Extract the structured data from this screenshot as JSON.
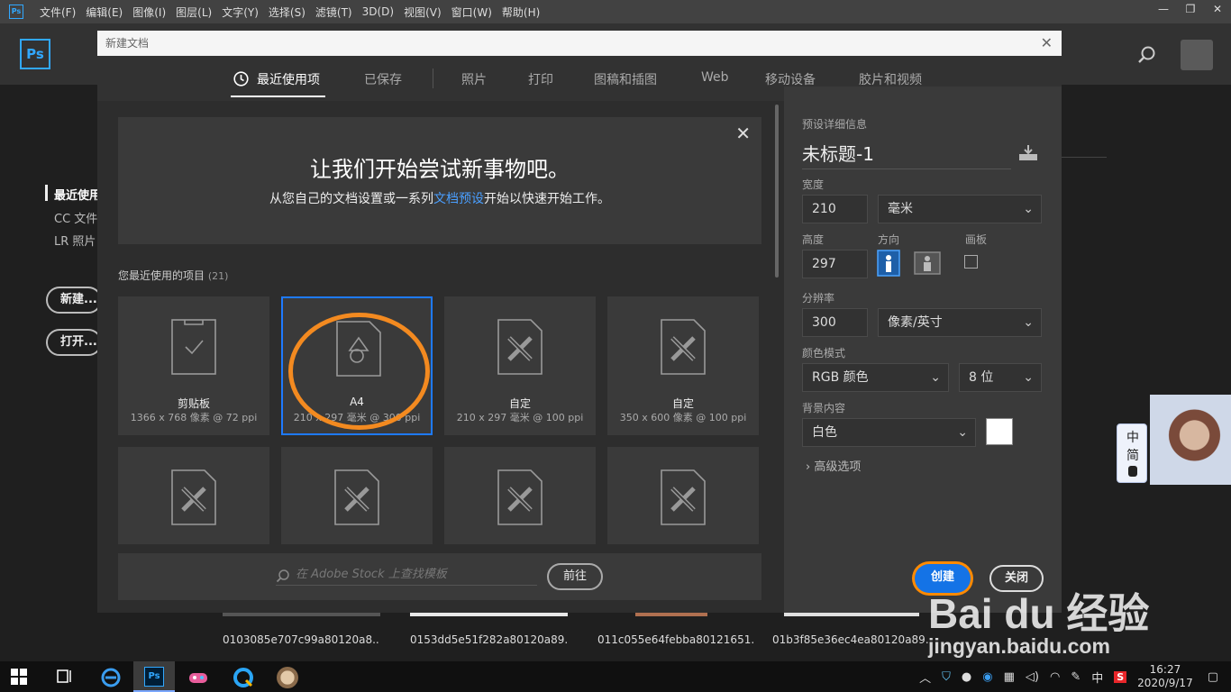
{
  "menubar": {
    "app_icon": "Ps",
    "items": [
      "文件(F)",
      "编辑(E)",
      "图像(I)",
      "图层(L)",
      "文字(Y)",
      "选择(S)",
      "滤镜(T)",
      "3D(D)",
      "视图(V)",
      "窗口(W)",
      "帮助(H)"
    ],
    "window_controls": [
      "—",
      "❐",
      "✕"
    ]
  },
  "home": {
    "logo": "Ps",
    "sidebar": [
      "最近使用",
      "CC 文件",
      "LR 照片"
    ],
    "new_button": "新建...",
    "open_button": "打开...",
    "recent_files": [
      {
        "name": "0103085e707c99a80120a8..."
      },
      {
        "name": "0153dd5e51f282a80120a89..."
      },
      {
        "name": "011c055e64febba80121651..."
      },
      {
        "name": "01b3f85e36ec4ea80120a89..."
      }
    ]
  },
  "dialog": {
    "title": "新建文档",
    "close_glyph": "✕",
    "tabs": [
      "最近使用项",
      "已保存",
      "照片",
      "打印",
      "图稿和插图",
      "Web",
      "移动设备",
      "胶片和视频"
    ],
    "banner": {
      "title": "让我们开始尝试新事物吧。",
      "sub_before": "从您自己的文档设置或一系列",
      "sub_link": "文档预设",
      "sub_after": "开始以快速开始工作。",
      "close_glyph": "✕"
    },
    "recent_label": "您最近使用的项目",
    "recent_count": "(21)",
    "presets": [
      {
        "name": "剪贴板",
        "sub": "1366 x 768 像素 @ 72 ppi",
        "icon": "clipboard-icon"
      },
      {
        "name": "A4",
        "sub": "210 x 297 毫米 @ 300 ppi",
        "icon": "document-shapes-icon"
      },
      {
        "name": "自定",
        "sub": "210 x 297 毫米 @ 100 ppi",
        "icon": "document-ruler-icon"
      },
      {
        "name": "自定",
        "sub": "350 x 600 像素 @ 100 ppi",
        "icon": "document-ruler-icon"
      },
      {
        "name": "",
        "sub": "",
        "icon": "document-ruler-icon"
      },
      {
        "name": "",
        "sub": "",
        "icon": "document-ruler-icon"
      },
      {
        "name": "",
        "sub": "",
        "icon": "document-ruler-icon"
      },
      {
        "name": "",
        "sub": "",
        "icon": "document-ruler-icon"
      }
    ],
    "stock": {
      "placeholder": "在 Adobe Stock 上查找模板",
      "go": "前往"
    },
    "details": {
      "section": "预设详细信息",
      "name": "未标题-1",
      "width_label": "宽度",
      "width": "210",
      "width_unit": "毫米",
      "height_label": "高度",
      "height": "297",
      "orientation_label": "方向",
      "artboard_label": "画板",
      "resolution_label": "分辨率",
      "resolution": "300",
      "resolution_unit": "像素/英寸",
      "color_mode_label": "颜色模式",
      "color_mode": "RGB 颜色",
      "bit_depth": "8 位",
      "background_label": "背景内容",
      "background": "白色",
      "advanced": "高级选项",
      "create": "创建",
      "close": "关闭"
    }
  },
  "ime": {
    "lang": "中",
    "mode": "简"
  },
  "watermark": {
    "logo": "Bai du 经验",
    "url": "jingyan.baidu.com"
  },
  "taskbar": {
    "ime": "中",
    "time": "16:27",
    "date": "2020/9/17"
  }
}
